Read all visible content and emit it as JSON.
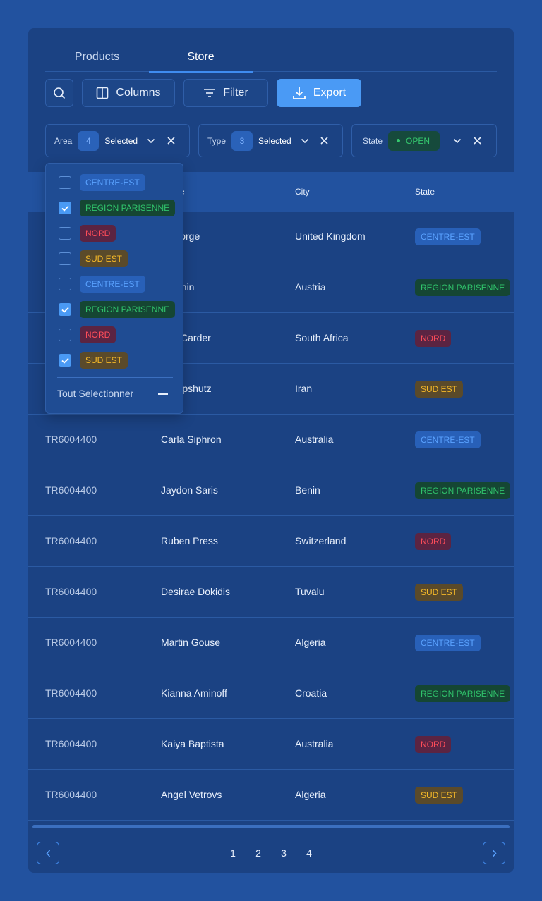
{
  "tabs": [
    {
      "label": "Products"
    },
    {
      "label": "Store"
    }
  ],
  "toolbar": {
    "columns_label": "Columns",
    "filter_label": "Filter",
    "export_label": "Export"
  },
  "filters": {
    "area": {
      "label": "Area",
      "count": "4",
      "status": "Selected"
    },
    "type": {
      "label": "Type",
      "count": "3",
      "status": "Selected"
    },
    "state": {
      "label": "State",
      "value": "OPEN"
    }
  },
  "table": {
    "headers": [
      "",
      "",
      "City",
      "State"
    ],
    "header_name_partial": "e",
    "rows": [
      {
        "id": "",
        "name": "r George",
        "city": "United Kingdom",
        "state": "CENTRE-EST"
      },
      {
        "id": "",
        "name": "y Donin",
        "city": "Austria",
        "state": "REGION PARISENNE"
      },
      {
        "id": "",
        "name": "ofer Carder",
        "city": "South Africa",
        "state": "NORD"
      },
      {
        "id": "",
        "name": "on Lipshutz",
        "city": "Iran",
        "state": "SUD EST"
      },
      {
        "id": "TR6004400",
        "name": "Carla Siphron",
        "city": "Australia",
        "state": "CENTRE-EST"
      },
      {
        "id": "TR6004400",
        "name": "Jaydon Saris",
        "city": "Benin",
        "state": "REGION PARISENNE"
      },
      {
        "id": "TR6004400",
        "name": "Ruben Press",
        "city": "Switzerland",
        "state": "NORD"
      },
      {
        "id": "TR6004400",
        "name": "Desirae Dokidis",
        "city": "Tuvalu",
        "state": "SUD EST"
      },
      {
        "id": "TR6004400",
        "name": "Martin Gouse",
        "city": "Algeria",
        "state": "CENTRE-EST"
      },
      {
        "id": "TR6004400",
        "name": "Kianna Aminoff",
        "city": "Croatia",
        "state": "REGION PARISENNE"
      },
      {
        "id": "TR6004400",
        "name": "Kaiya Baptista",
        "city": "Australia",
        "state": "NORD"
      },
      {
        "id": "TR6004400",
        "name": "Angel Vetrovs",
        "city": "Algeria",
        "state": "SUD EST"
      }
    ]
  },
  "dropdown": {
    "options": [
      {
        "label": "CENTRE-EST",
        "checked": false
      },
      {
        "label": "REGION PARISENNE",
        "checked": true
      },
      {
        "label": "NORD",
        "checked": false
      },
      {
        "label": "SUD EST",
        "checked": false
      },
      {
        "label": "CENTRE-EST",
        "checked": false
      },
      {
        "label": "REGION PARISENNE",
        "checked": true
      },
      {
        "label": "NORD",
        "checked": false
      },
      {
        "label": "SUD EST",
        "checked": true
      }
    ],
    "select_all_label": "Tout Selectionner"
  },
  "pagination": {
    "pages": [
      "1",
      "2",
      "3",
      "4"
    ]
  },
  "colors": {
    "background": "#22529f",
    "card": "#1b4283",
    "accent": "#4a9af5",
    "centre_est": "#5aa2ff",
    "region_parisenne": "#30c36b",
    "nord": "#ff4d5a",
    "sud_est": "#f5b928"
  },
  "icons": [
    "search-icon",
    "columns-icon",
    "filter-icon",
    "download-icon",
    "chevron-down-icon",
    "close-icon",
    "check-icon",
    "chevron-left-icon",
    "chevron-right-icon"
  ]
}
